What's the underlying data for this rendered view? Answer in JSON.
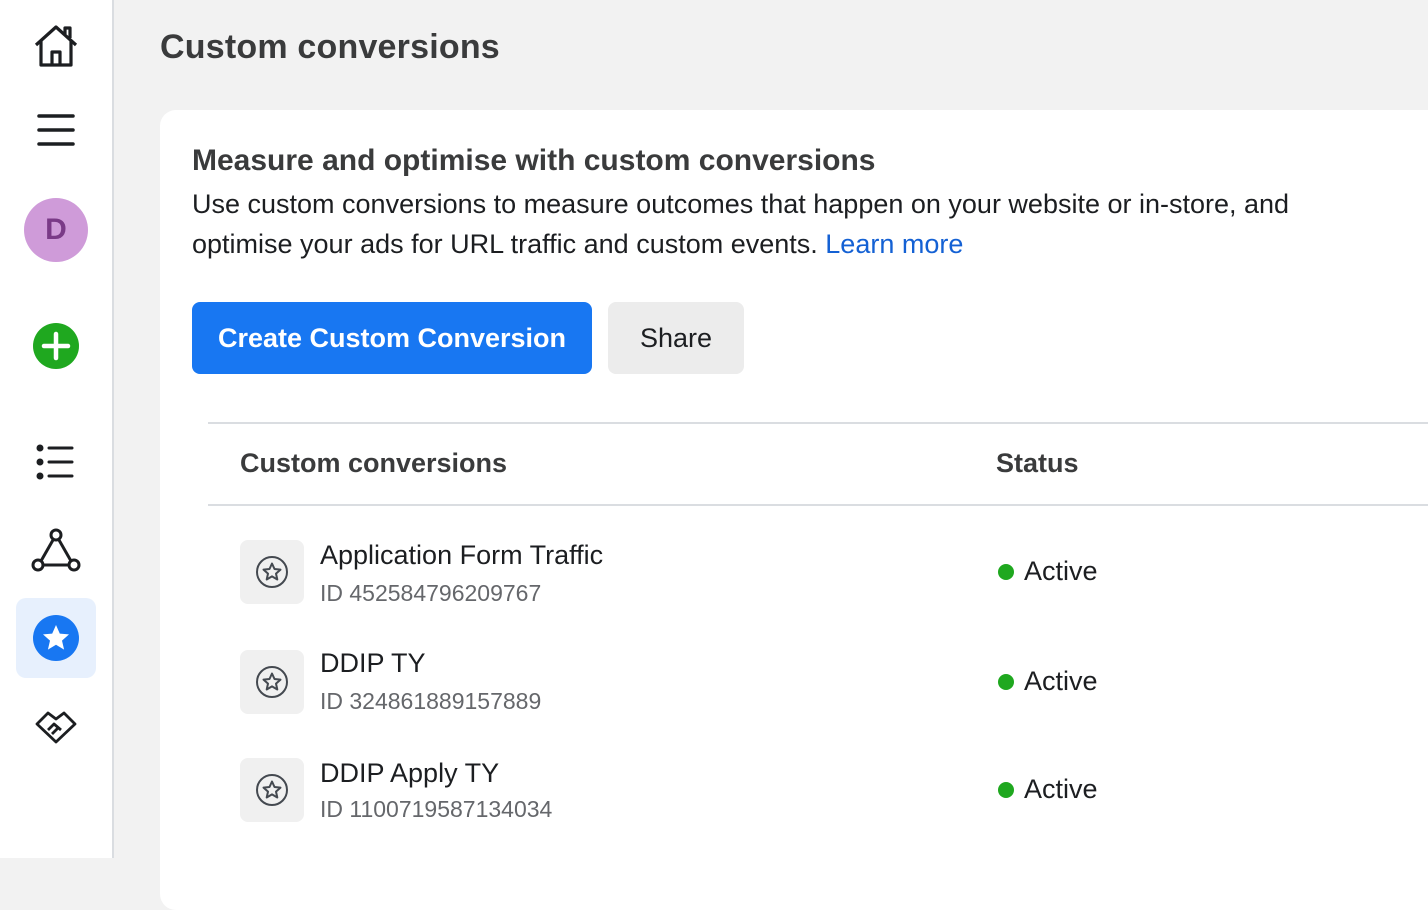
{
  "sidebar": {
    "items": [
      {
        "name": "home-icon"
      },
      {
        "name": "menu-icon"
      },
      {
        "name": "avatar",
        "letter": "D"
      },
      {
        "name": "create-icon"
      },
      {
        "name": "list-icon"
      },
      {
        "name": "graph-icon"
      },
      {
        "name": "star-icon",
        "selected": true
      },
      {
        "name": "handshake-icon"
      }
    ],
    "accent_color": "#1877f2",
    "create_color": "#1fa81f"
  },
  "page": {
    "title": "Custom conversions"
  },
  "card": {
    "heading": "Measure and optimise with custom conversions",
    "description": "Use custom conversions to measure outcomes that happen on your website or in-store, and optimise your ads for URL traffic and custom events.",
    "learn_more": "Learn more",
    "create_button": "Create Custom Conversion",
    "share_button": "Share"
  },
  "table": {
    "columns": [
      "Custom conversions",
      "Status"
    ],
    "rows": [
      {
        "name": "Application Form Traffic",
        "id_label": "ID",
        "id": "452584796209767",
        "status": "Active"
      },
      {
        "name": "DDIP TY",
        "id_label": "ID",
        "id": "324861889157889",
        "status": "Active"
      },
      {
        "name": "DDIP Apply TY",
        "id_label": "ID",
        "id": "1100719587134034",
        "status": "Active"
      }
    ],
    "status_color": "#1fa81f"
  }
}
